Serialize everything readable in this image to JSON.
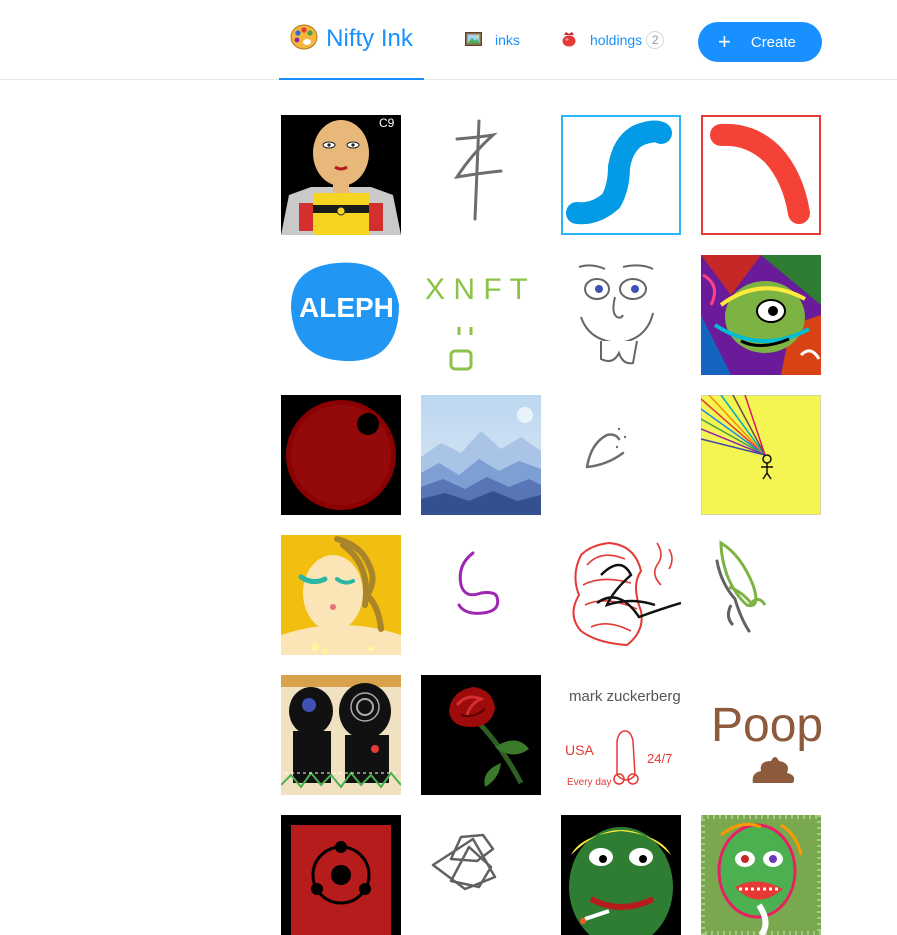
{
  "header": {
    "brand": {
      "title": "Nifty Ink",
      "icon": "palette-icon"
    },
    "nav": [
      {
        "label": "inks",
        "icon": "framed-picture-icon"
      },
      {
        "label": "holdings",
        "icon": "red-pouch-icon",
        "count": "2"
      }
    ],
    "create_button": {
      "label": "Create",
      "icon": "plus-icon"
    }
  },
  "gallery": {
    "items": [
      {
        "name": "bald-hero-ink",
        "caption": "C9"
      },
      {
        "name": "crossed-stick-ink"
      },
      {
        "name": "blue-squiggle-ink"
      },
      {
        "name": "red-arc-ink"
      },
      {
        "name": "aleph-ink",
        "caption": "ALEPH"
      },
      {
        "name": "xnft-ink",
        "caption": "X N F T"
      },
      {
        "name": "goofy-face-ink"
      },
      {
        "name": "colorful-face-ink"
      },
      {
        "name": "red-planet-ink"
      },
      {
        "name": "mountains-ink"
      },
      {
        "name": "small-sketch-ink"
      },
      {
        "name": "stick-figure-ink"
      },
      {
        "name": "blonde-woman-ink"
      },
      {
        "name": "purple-swirl-ink"
      },
      {
        "name": "red-scribble-face-ink"
      },
      {
        "name": "green-leaf-ink"
      },
      {
        "name": "dark-figures-ink"
      },
      {
        "name": "red-rose-ink"
      },
      {
        "name": "zuckerberg-ink",
        "caption": "mark zuckerberg",
        "caption2": "USA",
        "caption3": "24/7",
        "caption4": "Every day"
      },
      {
        "name": "poop-ink",
        "caption": "Poop"
      },
      {
        "name": "sharingan-ink"
      },
      {
        "name": "star-doodle-ink"
      },
      {
        "name": "pepe-ink"
      },
      {
        "name": "zombie-face-ink"
      }
    ]
  }
}
